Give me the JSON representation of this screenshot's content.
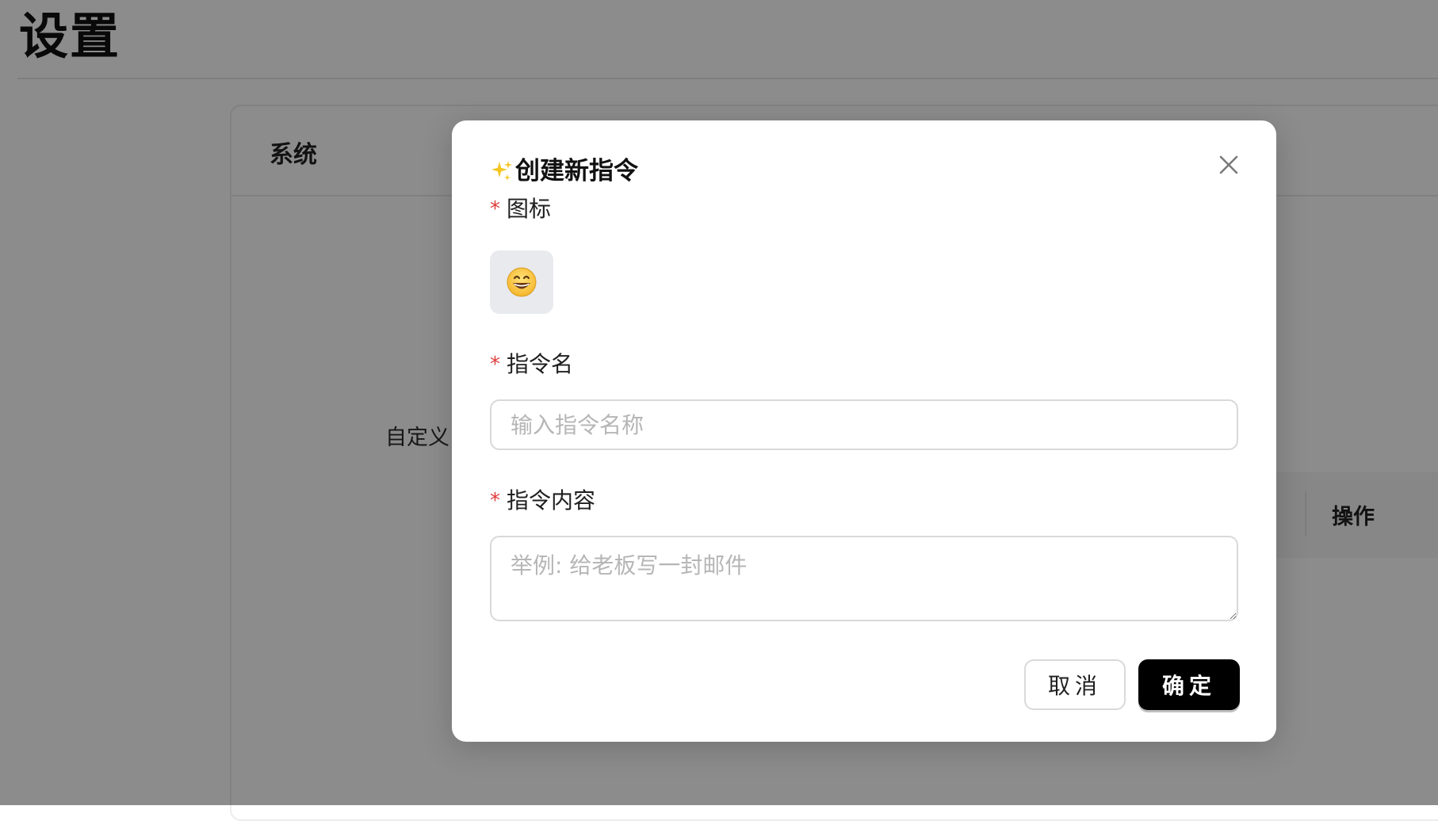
{
  "page": {
    "title": "设置"
  },
  "settings_card": {
    "header_title": "系统",
    "custom_label": "自定义",
    "table_actions_header": "操作"
  },
  "modal": {
    "title": "创建新指令",
    "title_icon": "sparkles-icon",
    "close_icon": "close-icon",
    "required_mark": "*",
    "icon_field": {
      "label": "图标",
      "selected_emoji": "😄",
      "selected_icon": "grinning-face-icon"
    },
    "name_field": {
      "label": "指令名",
      "placeholder": "输入指令名称",
      "value": ""
    },
    "content_field": {
      "label": "指令内容",
      "placeholder": "举例: 给老板写一封邮件",
      "value": ""
    },
    "buttons": {
      "cancel": "取消",
      "ok": "确定"
    }
  },
  "colors": {
    "primary_button": "#000000",
    "required_mark": "#e03c3c",
    "overlay": "rgba(0,0,0,0.45)",
    "icon_picker_bg": "#e8eaee"
  }
}
